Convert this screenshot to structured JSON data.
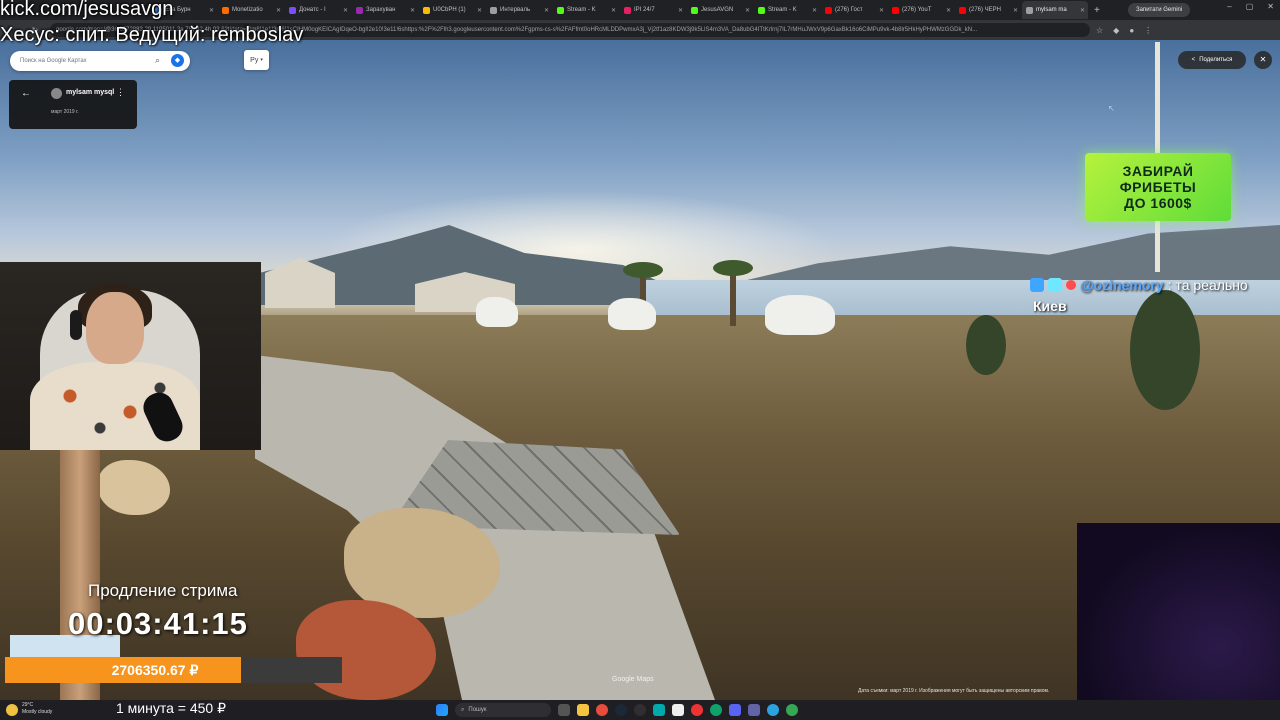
{
  "stream": {
    "channel": "kick.com/jesusavgn",
    "hosts": "Хесус: спит. Ведущий: remboslav",
    "extend_label": "Продление стрима",
    "timer": "00:03:41:15",
    "donation_total": "2706350.67 ₽",
    "donation_progress": 0.7,
    "rate": "1 минута = 450 ₽"
  },
  "ad": {
    "line1": "ЗАБИРАЙ",
    "line2": "ФРИБЕТЫ",
    "line3": "ДО 1600$"
  },
  "chat": {
    "username": "@ozinemory",
    "message": ": та реально",
    "username_tail": "Киев"
  },
  "browser": {
    "tabs": [
      {
        "label": "Ева Бурн",
        "color": "#4285f4"
      },
      {
        "label": "Monetizatio",
        "color": "#ff6d00"
      },
      {
        "label": "Донатс - I",
        "color": "#7c4dff"
      },
      {
        "label": "Зарахуван",
        "color": "#9c27b0"
      },
      {
        "label": "U0CbPH (1)",
        "color": "#fbbc04"
      },
      {
        "label": "Интерваль",
        "color": "#9e9e9e"
      },
      {
        "label": "Stream - K",
        "color": "#53fc18"
      },
      {
        "label": "IPI 24/7",
        "color": "#e91e63"
      },
      {
        "label": "JesusAVGN",
        "color": "#53fc18"
      },
      {
        "label": "Stream - K",
        "color": "#53fc18"
      },
      {
        "label": "(276) Гост",
        "color": "#ff0000"
      },
      {
        "label": "(276) YouT",
        "color": "#ff0000"
      },
      {
        "label": "(276) ЧЕРН",
        "color": "#ff0000"
      },
      {
        "label": "mylsam ma",
        "color": "#9aa0a6"
      }
    ],
    "active_tab": 13,
    "gemini": "Запитати Gemini",
    "url": "google.com/maps/@36.5572883,29.1195011,3a,75y,42.4h,93.62t/data=!3m8!1e1!3m6!1sCIHM0ogKEICAgIDqeO-bgl!2e10!3e11!6shttps:%2F%2Flh3.googleusercontent.com%2Fgpms-cs-s%2FAFfmt0oHRcMLDDPwmxA3j_Vj2tf1az8KDW3j9k5LlS4m3VA_Da8ubG4ITtKrlrnj7IL7rMHuJWxV9p6GaxBk16o6CiMPu9vk-4b8lr5HkHyPHWMzGGDk_kN..."
  },
  "maps": {
    "search_placeholder": "Поиск на Google Картах",
    "lang_button": "Ру",
    "place_name": "mylsam mysql",
    "place_date": "март 2019 г.",
    "share_label": "Поделиться",
    "watermark": "Google Maps",
    "footer": "Дата съемки: март 2019 г.    Изображения могут быть защищены авторским правом."
  },
  "taskbar": {
    "weather_temp": "29°C",
    "weather_desc": "Mostly cloudy",
    "search_label": "Пошук"
  },
  "icons": {
    "back": "arrow-left-icon",
    "more": "more-vert-icon",
    "share": "share-icon",
    "close": "close-icon",
    "search": "search-icon",
    "directions": "directions-icon"
  }
}
